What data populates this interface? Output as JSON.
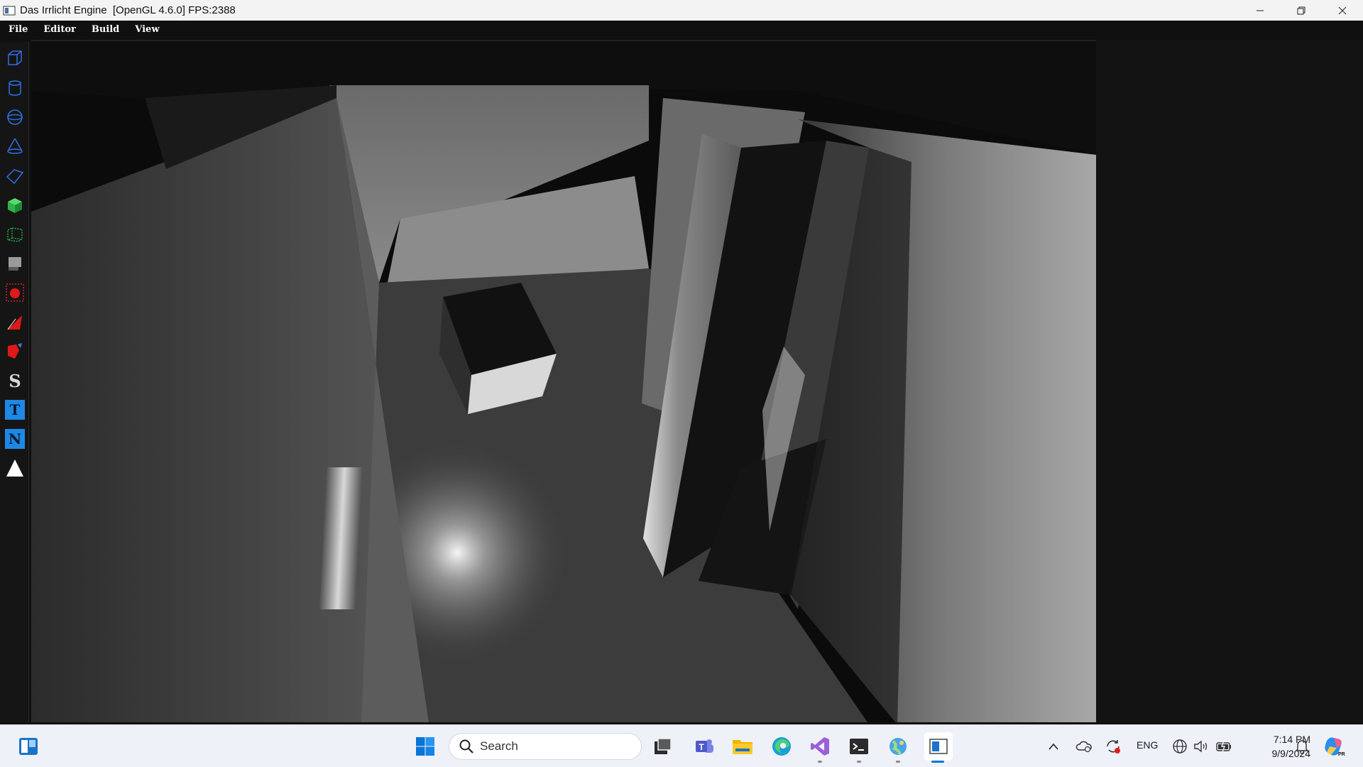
{
  "window": {
    "title": "Das Irrlicht Engine  [OpenGL 4.6.0] FPS:2388"
  },
  "menu": {
    "items": [
      "File",
      "Editor",
      "Build",
      "View"
    ]
  },
  "tools": [
    {
      "name": "cube-wireframe-tool-icon"
    },
    {
      "name": "cylinder-tool-icon"
    },
    {
      "name": "sphere-tool-icon"
    },
    {
      "name": "cone-tool-icon"
    },
    {
      "name": "plane-tool-icon"
    },
    {
      "name": "solid-cube-tool-icon"
    },
    {
      "name": "terrain-tool-icon"
    },
    {
      "name": "billboard-tool-icon"
    },
    {
      "name": "point-light-tool-icon"
    },
    {
      "name": "spot-light-tool-icon"
    },
    {
      "name": "directional-light-tool-icon"
    },
    {
      "name": "script-tool-icon",
      "letter": "S"
    },
    {
      "name": "text-tool-icon",
      "letter": "T"
    },
    {
      "name": "node-tool-icon",
      "letter": "N"
    },
    {
      "name": "triangle-tool-icon"
    }
  ],
  "taskbar": {
    "search_placeholder": "Search",
    "language": "ENG",
    "time": "7:14 PM",
    "date": "9/9/2024"
  },
  "colors": {
    "accent": "#0078d4",
    "tool_blue": "#2f6fe0",
    "tool_green": "#2db34a",
    "tool_red": "#e01818",
    "tool_letter_bg": "#1e88e5"
  }
}
